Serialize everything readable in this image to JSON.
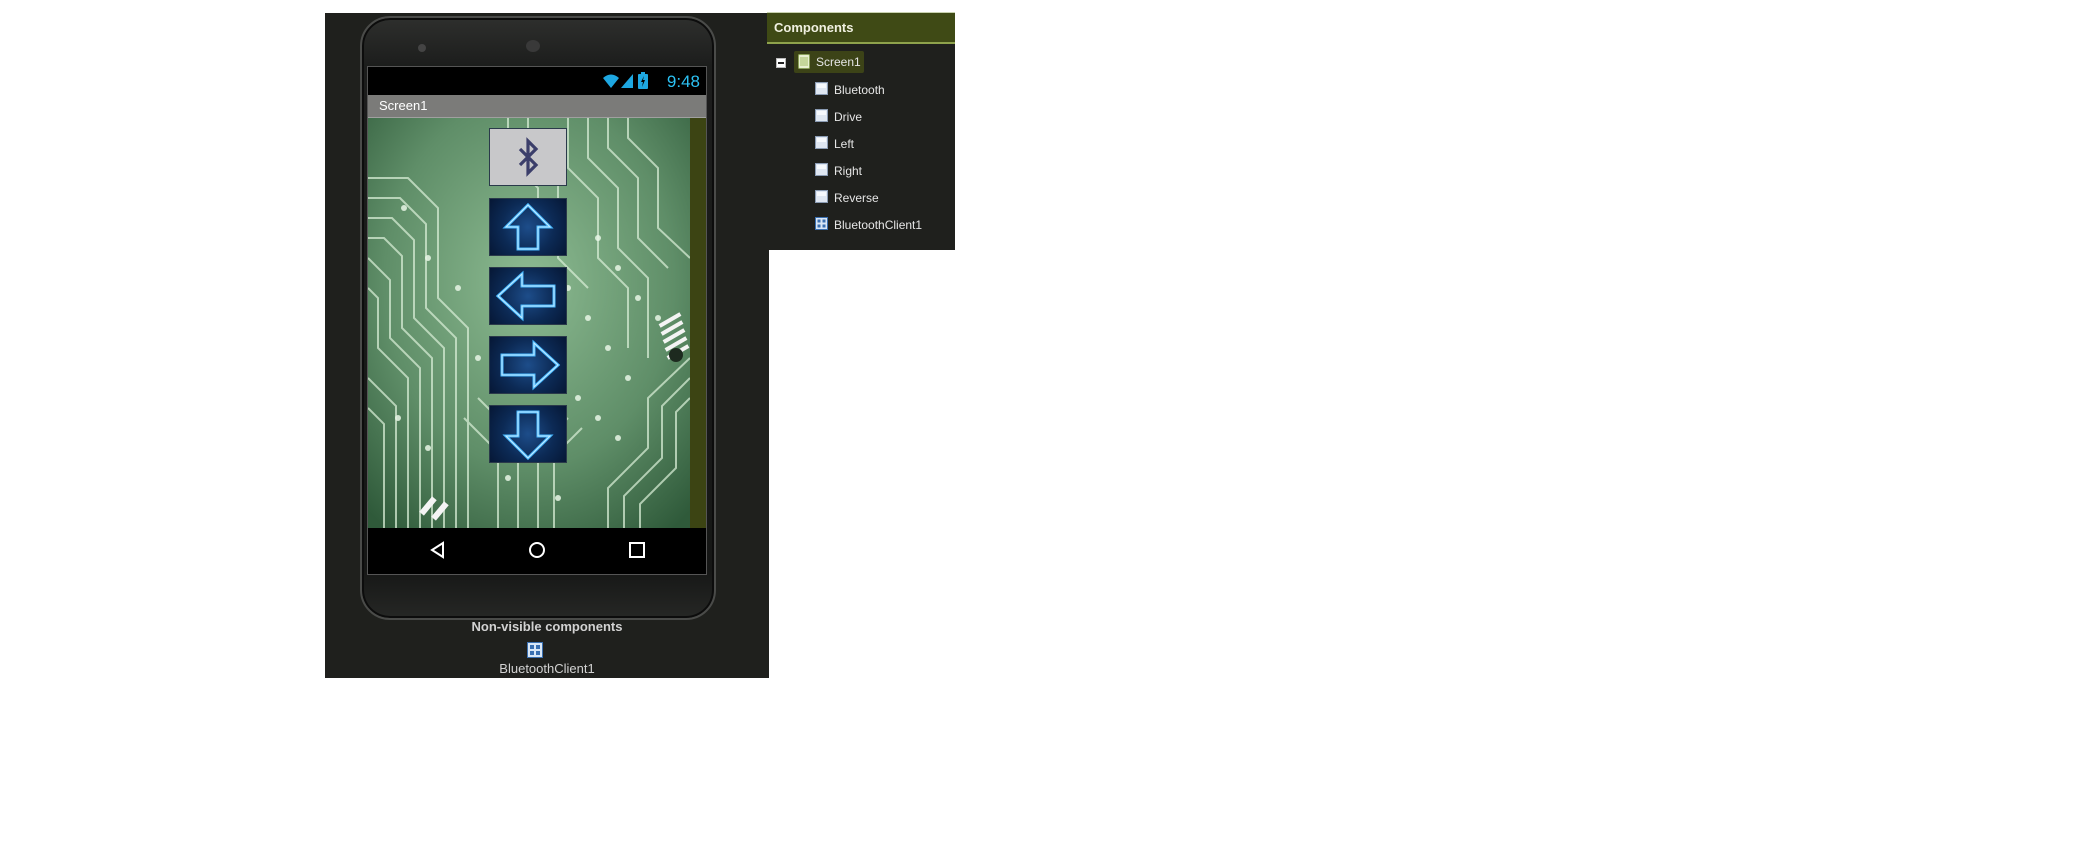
{
  "designer": {
    "status_time": "9:48",
    "screen_title": "Screen1",
    "non_visible_title": "Non-visible components",
    "non_visible_items": [
      {
        "label": "BluetoothClient1",
        "icon": "bluetooth-client-icon"
      }
    ]
  },
  "components": {
    "header": "Components",
    "root": {
      "label": "Screen1",
      "icon": "screen-icon"
    },
    "children": [
      {
        "label": "Bluetooth",
        "icon": "button-icon"
      },
      {
        "label": "Drive",
        "icon": "button-icon"
      },
      {
        "label": "Left",
        "icon": "button-icon"
      },
      {
        "label": "Right",
        "icon": "button-icon"
      },
      {
        "label": "Reverse",
        "icon": "button-icon"
      },
      {
        "label": "BluetoothClient1",
        "icon": "bluetooth-client-icon"
      }
    ]
  },
  "colors": {
    "panel_bg": "#1f201d",
    "header_bg": "#3f4a15",
    "status_accent": "#2cc1f3",
    "neon_blue": "#3aa0ff"
  }
}
